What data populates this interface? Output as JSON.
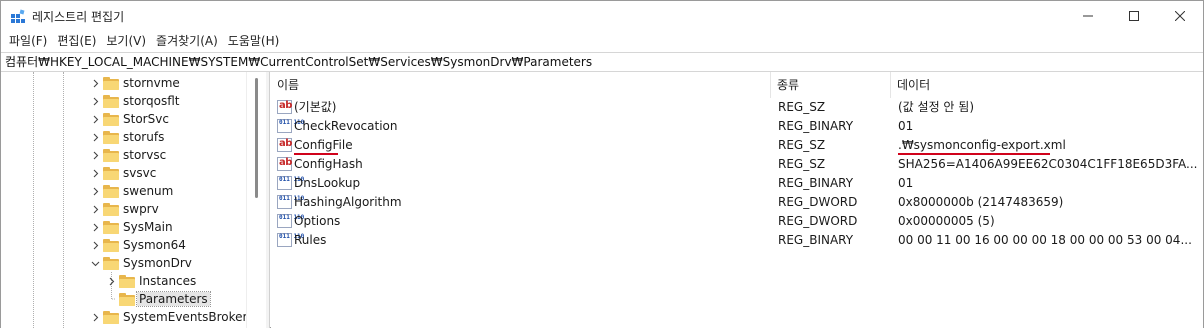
{
  "window": {
    "title": "레지스트리 편집기",
    "controls": {
      "minimize": "—",
      "maximize": "☐",
      "close": "✕"
    }
  },
  "menu": [
    "파일(F)",
    "편집(E)",
    "보기(V)",
    "즐겨찾기(A)",
    "도움말(H)"
  ],
  "address": "컴퓨터₩HKEY_LOCAL_MACHINE₩SYSTEM₩CurrentControlSet₩Services₩SysmonDrv₩Parameters",
  "tree": [
    {
      "label": "stornvme",
      "expanded": false,
      "selected": false
    },
    {
      "label": "storqosflt",
      "expanded": false,
      "selected": false
    },
    {
      "label": "StorSvc",
      "expanded": false,
      "selected": false
    },
    {
      "label": "storufs",
      "expanded": false,
      "selected": false
    },
    {
      "label": "storvsc",
      "expanded": false,
      "selected": false
    },
    {
      "label": "svsvc",
      "expanded": false,
      "selected": false
    },
    {
      "label": "swenum",
      "expanded": false,
      "selected": false
    },
    {
      "label": "swprv",
      "expanded": false,
      "selected": false
    },
    {
      "label": "SysMain",
      "expanded": false,
      "selected": false
    },
    {
      "label": "Sysmon64",
      "expanded": false,
      "selected": false
    },
    {
      "label": "SysmonDrv",
      "expanded": true,
      "selected": false
    },
    {
      "label": "Instances",
      "expanded": false,
      "selected": false,
      "child": true
    },
    {
      "label": "Parameters",
      "expanded": false,
      "selected": true,
      "child": true,
      "nochevron": true
    },
    {
      "label": "SystemEventsBroker",
      "expanded": false,
      "selected": false
    }
  ],
  "columns": {
    "name": "이름",
    "type": "종류",
    "data": "데이터"
  },
  "values": [
    {
      "name": "(기본값)",
      "type": "REG_SZ",
      "data": "(값 설정 안 됨)",
      "icon": "sz"
    },
    {
      "name": "CheckRevocation",
      "type": "REG_BINARY",
      "data": "01",
      "icon": "bin"
    },
    {
      "name": "ConfigFile",
      "type": "REG_SZ",
      "data": ".₩sysmonconfig-export.xml",
      "icon": "sz",
      "highlight": true
    },
    {
      "name": "ConfigHash",
      "type": "REG_SZ",
      "data": "SHA256=A1406A99EE62C0304C1FF18E65D3FA...",
      "icon": "sz"
    },
    {
      "name": "DnsLookup",
      "type": "REG_BINARY",
      "data": "01",
      "icon": "bin"
    },
    {
      "name": "HashingAlgorithm",
      "type": "REG_DWORD",
      "data": "0x8000000b (2147483659)",
      "icon": "bin"
    },
    {
      "name": "Options",
      "type": "REG_DWORD",
      "data": "0x00000005 (5)",
      "icon": "bin"
    },
    {
      "name": "Rules",
      "type": "REG_BINARY",
      "data": "00 00 11 00 16 00 00 00 18 00 00 00 53 00 04...",
      "icon": "bin"
    }
  ],
  "icons": {
    "string_value": "ab",
    "binary_value": "011 110"
  },
  "colors": {
    "highlight_underline": "#d0021b",
    "folder": "#f8d775"
  }
}
